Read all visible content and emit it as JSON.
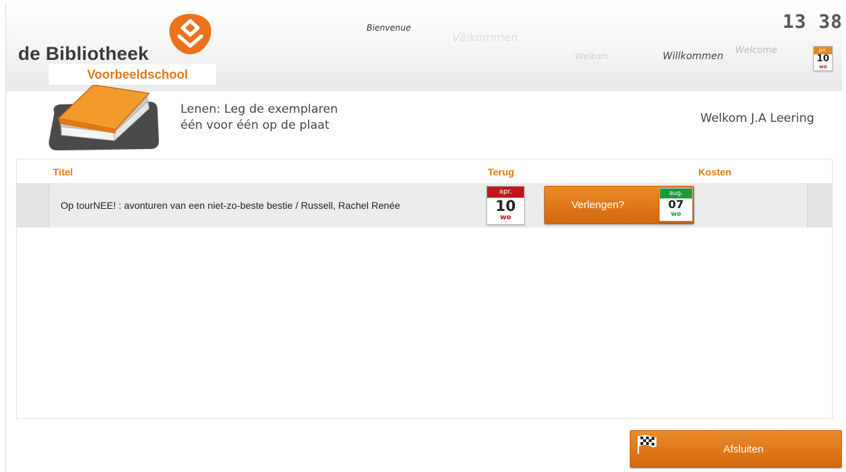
{
  "header": {
    "logo_text": "de Bibliotheek",
    "school_name": "Voorbeeldschool",
    "greetings": {
      "bienvenue": "Bienvenue",
      "valkommen": "Välkommen",
      "welkom": "Welkom",
      "willkommen": "Willkommen",
      "welcome": "Welcome"
    },
    "clock": "13 38",
    "date": {
      "month": "jul.",
      "day": "10",
      "weekday": "wo"
    }
  },
  "instruction": {
    "line1": "Lenen: Leg de exemplaren",
    "line2": "één voor één op de plaat"
  },
  "user_welcome": "Welkom J.A Leering",
  "table": {
    "columns": {
      "title": "Titel",
      "due": "Terug",
      "cost": "Kosten"
    },
    "rows": [
      {
        "title": "Op tourNEE! : avonturen van een niet-zo-beste bestie / Russell, Rachel Renée",
        "due": {
          "month": "apr.",
          "day": "10",
          "weekday": "wo"
        },
        "renew_label": "Verlengen?",
        "renew_date": {
          "month": "aug.",
          "day": "07",
          "weekday": "wo"
        }
      }
    ]
  },
  "close_button": {
    "label": "Afsluiten",
    "icon": "checkered-flag-icon"
  },
  "colors": {
    "brand_orange": "#e07816",
    "due_red": "#c0161c",
    "renew_green": "#1d9b3a"
  }
}
